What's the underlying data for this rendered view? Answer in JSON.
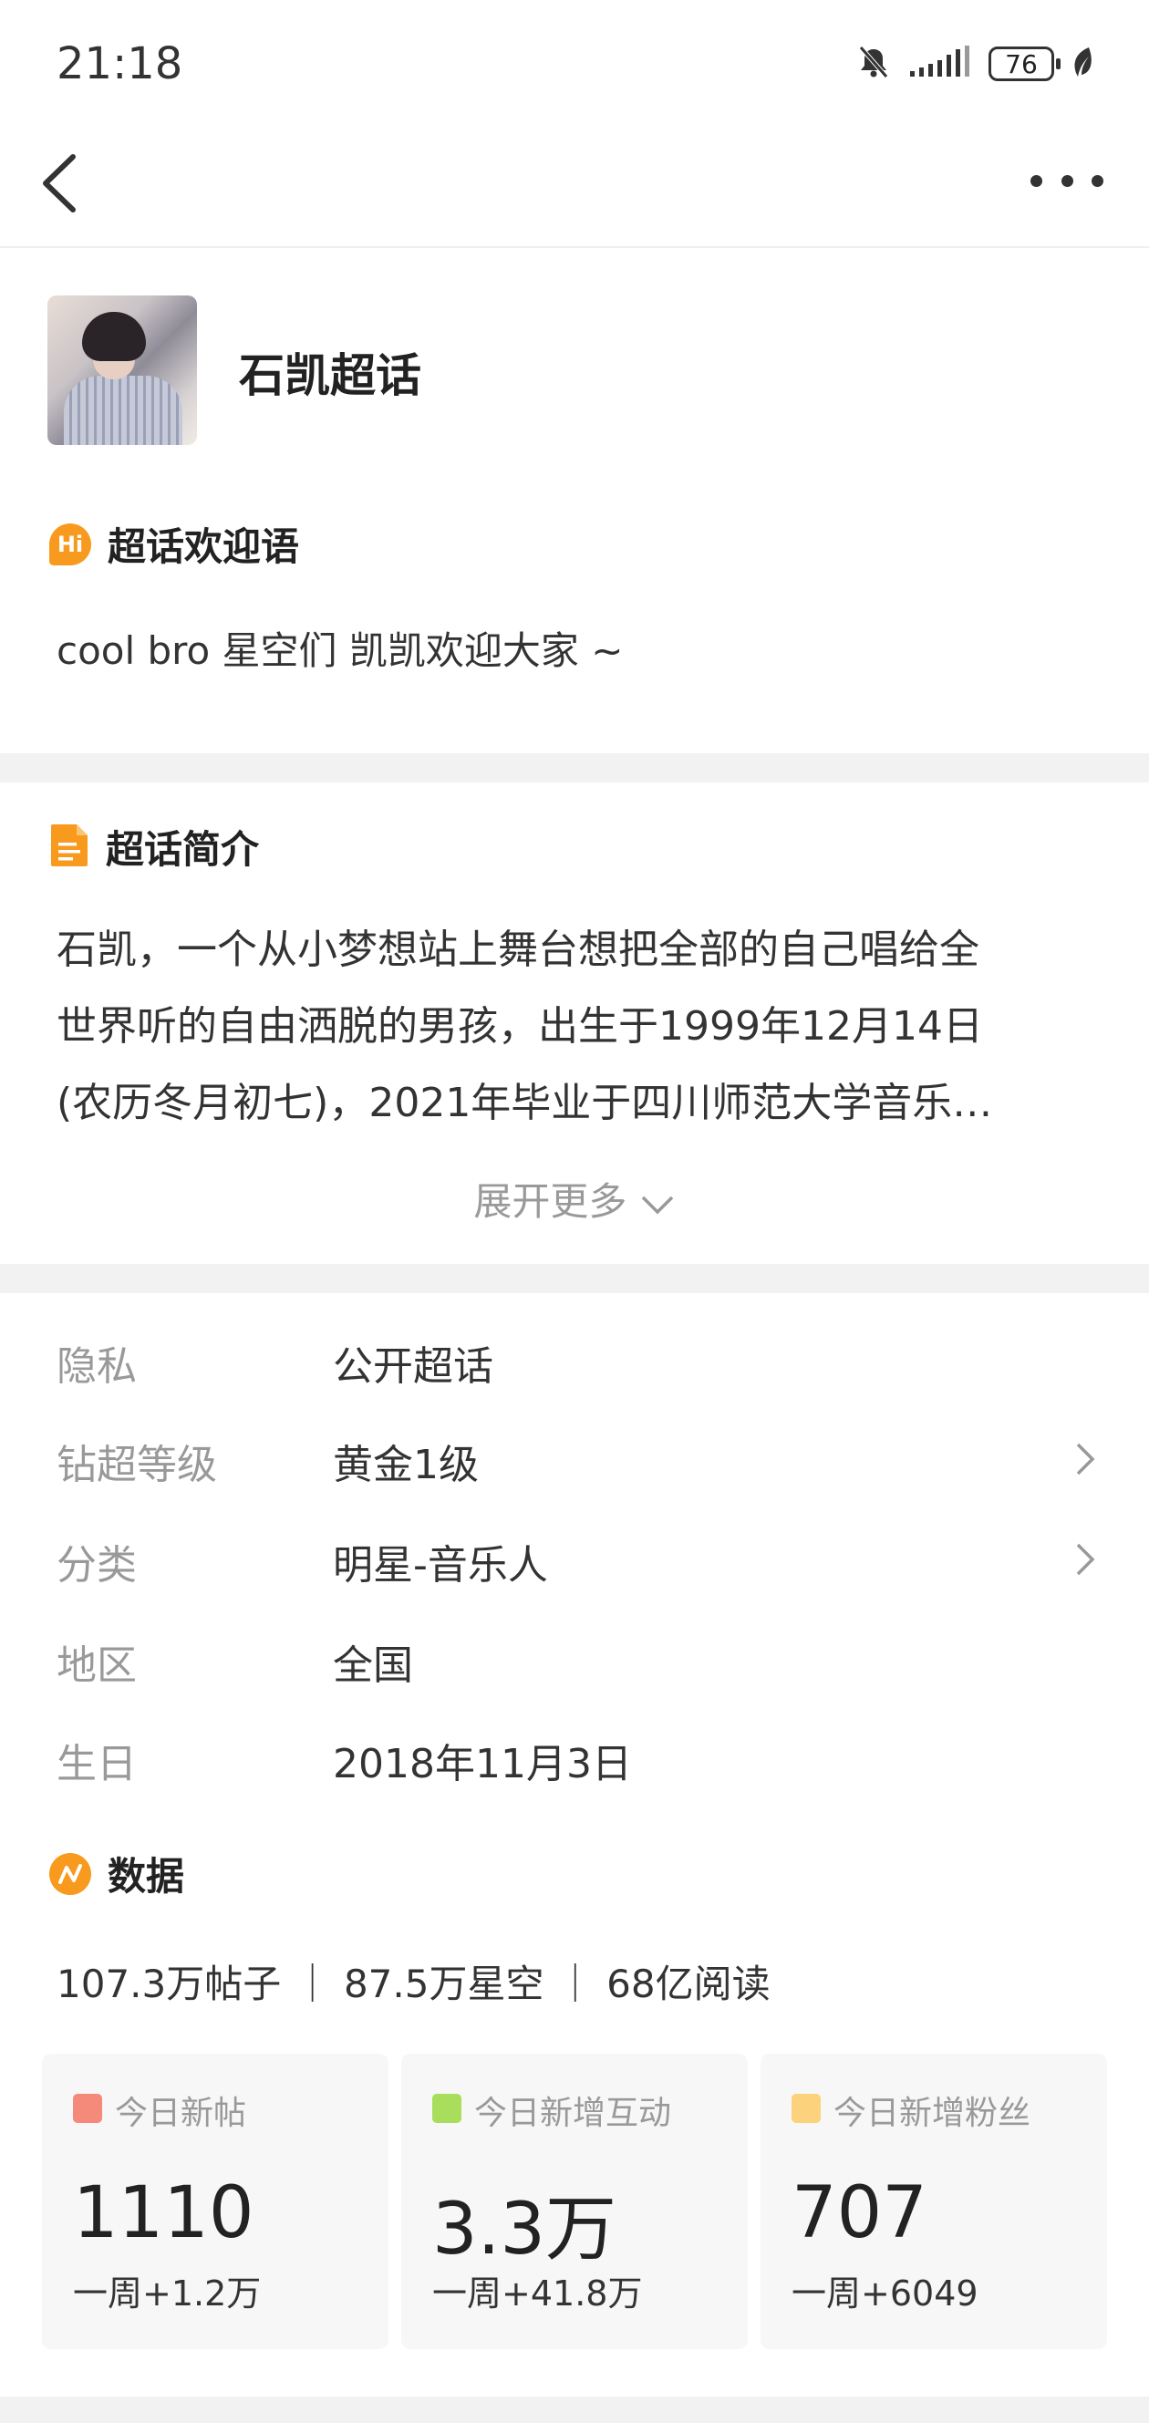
{
  "status_bar": {
    "time": "21:18",
    "battery": "76"
  },
  "header": {
    "title": "石凯超话"
  },
  "welcome": {
    "heading": "超话欢迎语",
    "icon_text": "Hi",
    "text": "cool bro 星空们 凯凯欢迎大家 ~"
  },
  "intro": {
    "heading": "超话简介",
    "lines": [
      "石凯，一个从小梦想站上舞台想把全部的自己唱给全",
      "世界听的自由洒脱的男孩，出生于1999年12月14日",
      "(农历冬月初七)，2021年毕业于四川师范大学音乐…"
    ],
    "expand_label": "展开更多"
  },
  "info_rows": [
    {
      "label": "隐私",
      "value": "公开超话"
    },
    {
      "label": "钻超等级",
      "value": "黄金1级"
    },
    {
      "label": "分类",
      "value": "明星-音乐人"
    },
    {
      "label": "地区",
      "value": "全国"
    },
    {
      "label": "生日",
      "value": "2018年11月3日"
    }
  ],
  "data_section": {
    "heading": "数据",
    "summary": "107.3万帖子 ｜ 87.5万星空 ｜ 68亿阅读",
    "cards": [
      {
        "caption": "今日新帖",
        "value": "1110",
        "weekly": "一周+1.2万",
        "color": "#f5897a"
      },
      {
        "caption": "今日新增互动",
        "value": "3.3万",
        "weekly": "一周+41.8万",
        "color": "#a9dd5c"
      },
      {
        "caption": "今日新增粉丝",
        "value": "707",
        "weekly": "一周+6049",
        "color": "#fdd27c"
      }
    ]
  },
  "colors": {
    "accent_orange": "#f79a1e",
    "muted": "#999999",
    "divider": "#f2f2f2"
  }
}
